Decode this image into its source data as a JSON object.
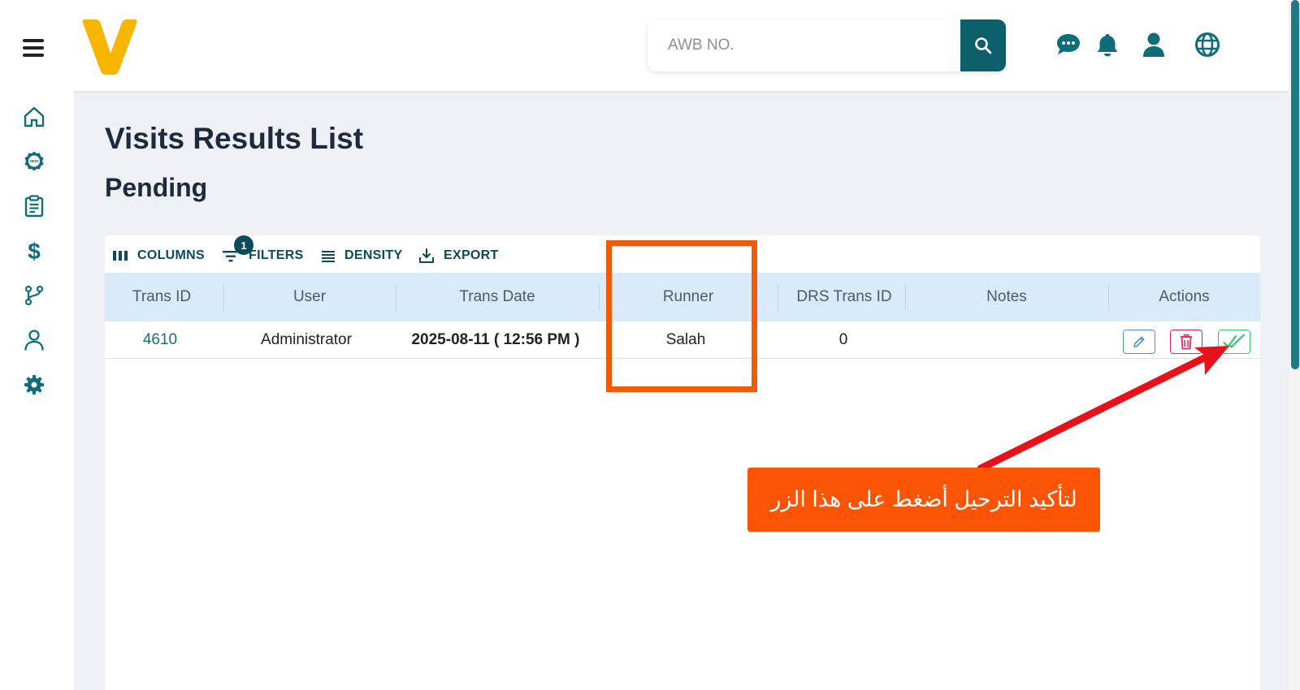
{
  "header": {
    "search_placeholder": "AWB NO."
  },
  "icons": {
    "menu": "hamburger-icon",
    "search": "search-icon",
    "chat": "chat-icon",
    "notifications": "bell-icon",
    "profile": "user-icon",
    "language": "globe-icon"
  },
  "sidebar": {
    "items": [
      {
        "icon": "home-icon"
      },
      {
        "icon": "new-badge-icon"
      },
      {
        "icon": "clipboard-icon"
      },
      {
        "icon": "dollar-icon"
      },
      {
        "icon": "branch-icon"
      },
      {
        "icon": "person-icon"
      },
      {
        "icon": "gear-icon"
      }
    ]
  },
  "page": {
    "title": "Visits Results List",
    "subtitle": "Pending"
  },
  "toolbar": {
    "columns": "COLUMNS",
    "filters": "FILTERS",
    "filter_count": "1",
    "density": "DENSITY",
    "export": "EXPORT"
  },
  "table": {
    "columns": [
      "Trans ID",
      "User",
      "Trans Date",
      "Runner",
      "DRS Trans ID",
      "Notes",
      "Actions"
    ],
    "rows": [
      {
        "trans_id": "4610",
        "user": "Administrator",
        "trans_date": "2025-08-11 ( 12:56 PM )",
        "runner": "Salah",
        "drs_trans_id": "0",
        "notes": ""
      }
    ]
  },
  "annotation": {
    "callout_text": "لتأكيد الترحيل أضغط على هذا الزر"
  },
  "colors": {
    "accent": "#0d5f6b",
    "logo": "#f7b500",
    "annotation": "#fb5404",
    "arrow": "#e8101a",
    "header_row": "#d9eafa"
  }
}
